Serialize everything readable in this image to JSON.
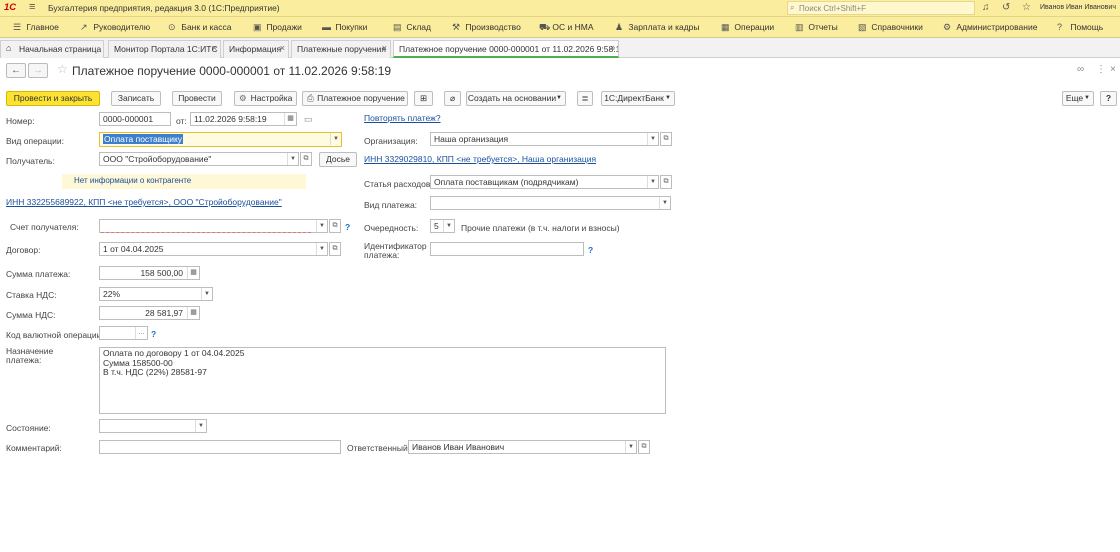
{
  "app": {
    "logo": "1С",
    "title": "Бухгалтерия предприятия, редакция 3.0  (1С:Предприятие)",
    "search_placeholder": "Поиск Ctrl+Shift+F",
    "user": "Иванов Иван Иванович"
  },
  "menu": [
    {
      "label": "Главное",
      "icon": "home-icon",
      "glyph": "☰"
    },
    {
      "label": "Руководителю",
      "icon": "chart-icon",
      "glyph": "↗"
    },
    {
      "label": "Банк и касса",
      "icon": "bank-icon",
      "glyph": "⊙"
    },
    {
      "label": "Продажи",
      "icon": "sales-icon",
      "glyph": "▣"
    },
    {
      "label": "Покупки",
      "icon": "cart-icon",
      "glyph": "▬"
    },
    {
      "label": "Склад",
      "icon": "warehouse-icon",
      "glyph": "▤"
    },
    {
      "label": "Производство",
      "icon": "production-icon",
      "glyph": "⚒"
    },
    {
      "label": "ОС и НМА",
      "icon": "truck-icon",
      "glyph": "⛟"
    },
    {
      "label": "Зарплата и кадры",
      "icon": "person-icon",
      "glyph": "♟"
    },
    {
      "label": "Операции",
      "icon": "operations-icon",
      "glyph": "▦"
    },
    {
      "label": "Отчеты",
      "icon": "reports-icon",
      "glyph": "▥"
    },
    {
      "label": "Справочники",
      "icon": "catalog-icon",
      "glyph": "▧"
    },
    {
      "label": "Администрирование",
      "icon": "admin-gear-icon",
      "glyph": "⚙"
    },
    {
      "label": "Помощь",
      "icon": "help-icon",
      "glyph": "?"
    }
  ],
  "tabs": [
    {
      "label": "Начальная страница"
    },
    {
      "label": "Монитор Портала 1С:ИТС"
    },
    {
      "label": "Информация"
    },
    {
      "label": "Платежные поручения"
    },
    {
      "label": "Платежное поручение 0000-000001 от 11.02.2026 9:58:19"
    }
  ],
  "form": {
    "title": "Платежное поручение 0000-000001 от 11.02.2026 9:58:19"
  },
  "toolbar": {
    "post_close": "Провести и закрыть",
    "save": "Записать",
    "post": "Провести",
    "settings": "Настройка",
    "payment_order": "Платежное поручение",
    "create_based": "Создать на основании",
    "direct_bank": "1С:ДиректБанк",
    "more": "Еще",
    "help": "?"
  },
  "fields": {
    "number_label": "Номер:",
    "number": "0000-000001",
    "from_label": "от:",
    "date": "11.02.2026  9:58:19",
    "op_type_label": "Вид операции:",
    "op_type": "Оплата поставщику",
    "recipient_label": "Получатель:",
    "recipient": "ООО \"Стройоборудование\"",
    "dossier": "Досье",
    "no_info": "Нет информации о контрагенте",
    "recipient_inn": "ИНН 332255689922, КПП <не требуется>, ООО \"Стройоборудование\"",
    "account_label": "Счет получателя:",
    "contract_label": "Договор:",
    "contract": "1 от 04.04.2025",
    "amount_label": "Сумма платежа:",
    "amount": "158 500,00",
    "vat_rate_label": "Ставка НДС:",
    "vat_rate": "22%",
    "vat_amount_label": "Сумма НДС:",
    "vat_amount": "28 581,97",
    "currency_op_label": "Код валютной операции:",
    "purpose_label": "Назначение платежа:",
    "purpose_lines": [
      "Оплата по договору 1 от 04.04.2025",
      "Сумма 158500-00",
      "В т.ч. НДС  (22%) 28581-97"
    ],
    "state_label": "Состояние:",
    "comment_label": "Комментарий:",
    "responsible_label": "Ответственный:",
    "responsible": "Иванов Иван Иванович",
    "repeat_payment": "Повторять платеж?",
    "org_label": "Организация:",
    "org": "Наша организация",
    "org_inn": "ИНН 3329029810, КПП <не требуется>, Наша организация",
    "expense_label": "Статья расходов:",
    "expense": "Оплата поставщикам (подрядчикам)",
    "payment_kind_label": "Вид платежа:",
    "priority_label": "Очередность:",
    "priority": "5",
    "priority_text": "Прочие платежи (в т.ч. налоги и взносы)",
    "payment_id_label": "Идентификатор платежа:",
    "q": "?"
  }
}
